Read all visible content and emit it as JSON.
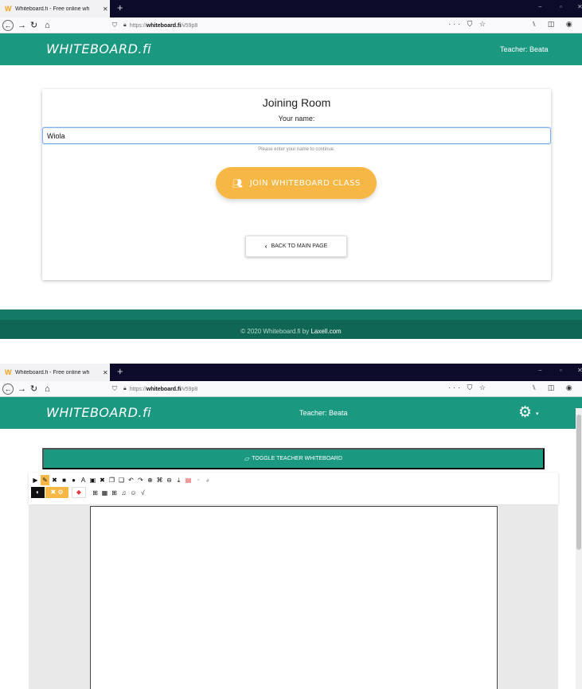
{
  "browser": {
    "tab_title": "Whiteboard.fi - Free online wh",
    "tab_close": "✕",
    "new_tab": "+",
    "window_min": "−",
    "window_restore": "▫",
    "window_close": "✕",
    "url_prefix": "https://",
    "url_host": "whiteboard.fi",
    "url_path": "/v59p8",
    "page_actions": "··· ⛉ ☆",
    "toolbar_icons": "⑊ ◫ ◉ ⋮"
  },
  "header": {
    "logo": "WHITEBOARD.fi",
    "teacher": "Teacher: Beata"
  },
  "join": {
    "title": "Joining Room",
    "subtitle": "Your name:",
    "name_value": "Wiola",
    "hint": "Please enter your name to continue.",
    "join_button": "JOIN WHITEBOARD CLASS",
    "back_button": "BACK TO MAIN PAGE"
  },
  "footer": {
    "text": "© 2020 Whiteboard.fi by ",
    "link": "Laxell.com"
  },
  "board": {
    "toggle_button": "TOGGLE TEACHER WHITEBOARD",
    "tools_row1": [
      {
        "name": "pointer-tool-icon",
        "glyph": "▶"
      },
      {
        "name": "pen-tool-icon",
        "glyph": "✎"
      },
      {
        "name": "line-tool-icon",
        "glyph": "✖"
      },
      {
        "name": "rectangle-tool-icon",
        "glyph": "■"
      },
      {
        "name": "circle-tool-icon",
        "glyph": "●"
      },
      {
        "name": "text-tool-icon",
        "glyph": "A"
      },
      {
        "name": "textbox-tool-icon",
        "glyph": "▣"
      },
      {
        "name": "delete-tool-icon",
        "glyph": "✖"
      },
      {
        "name": "copy-tool-icon",
        "glyph": "❐"
      },
      {
        "name": "paste-tool-icon",
        "glyph": "❏"
      },
      {
        "name": "undo-tool-icon",
        "glyph": "↶"
      },
      {
        "name": "redo-tool-icon",
        "glyph": "↷"
      },
      {
        "name": "zoom-in-tool-icon",
        "glyph": "⊕"
      },
      {
        "name": "fit-tool-icon",
        "glyph": "⌘"
      },
      {
        "name": "zoom-out-tool-icon",
        "glyph": "⊖"
      },
      {
        "name": "download-tool-icon",
        "glyph": "⤓"
      },
      {
        "name": "clear-tool-icon",
        "glyph": "▤"
      },
      {
        "name": "hide-tool-icon",
        "glyph": "◔"
      },
      {
        "name": "show-tool-icon",
        "glyph": "◕"
      }
    ],
    "tools_row2": [
      {
        "name": "image-tool-icon",
        "glyph": "⊞"
      },
      {
        "name": "grid-tool-icon",
        "glyph": "▦"
      },
      {
        "name": "table-tool-icon",
        "glyph": "⊞"
      },
      {
        "name": "music-tool-icon",
        "glyph": "♫"
      },
      {
        "name": "emoji-tool-icon",
        "glyph": "☺"
      },
      {
        "name": "math-tool-icon",
        "glyph": "√"
      }
    ],
    "swatch_dark": "◐",
    "swatch_orange": "✖ ⚙",
    "swatch_eraser": "◆",
    "gear_caret": "▾"
  },
  "colors": {
    "header": "#1a9880",
    "accent": "#f7b744",
    "tabbar": "#0c0c2a"
  }
}
